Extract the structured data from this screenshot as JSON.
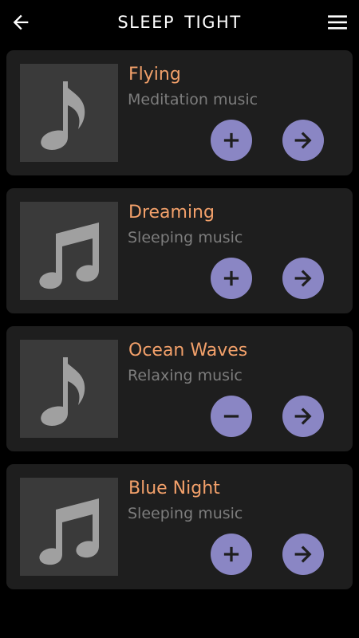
{
  "header": {
    "title": "SLEEP  TIGHT",
    "back_icon": "arrow-left-icon",
    "menu_icon": "hamburger-menu-icon"
  },
  "colors": {
    "background": "#000000",
    "card": "#1e1e1e",
    "thumbnail": "#3a3a3a",
    "title_accent": "#f2a06a",
    "subtitle": "#7d7d7d",
    "button": "#8a86c4",
    "button_icon": "#1e1e1e"
  },
  "tracks": [
    {
      "title": "Flying",
      "subtitle": "Meditation music",
      "note_icon": "single-music-note-icon",
      "toggle_icon": "plus-icon",
      "go_icon": "arrow-right-icon"
    },
    {
      "title": "Dreaming",
      "subtitle": "Sleeping music",
      "note_icon": "double-music-note-icon",
      "toggle_icon": "plus-icon",
      "go_icon": "arrow-right-icon"
    },
    {
      "title": "Ocean Waves",
      "subtitle": "Relaxing music",
      "note_icon": "single-music-note-icon",
      "toggle_icon": "minus-icon",
      "go_icon": "arrow-right-icon"
    },
    {
      "title": "Blue Night",
      "subtitle": "Sleeping music",
      "note_icon": "double-music-note-icon",
      "toggle_icon": "plus-icon",
      "go_icon": "arrow-right-icon"
    }
  ]
}
